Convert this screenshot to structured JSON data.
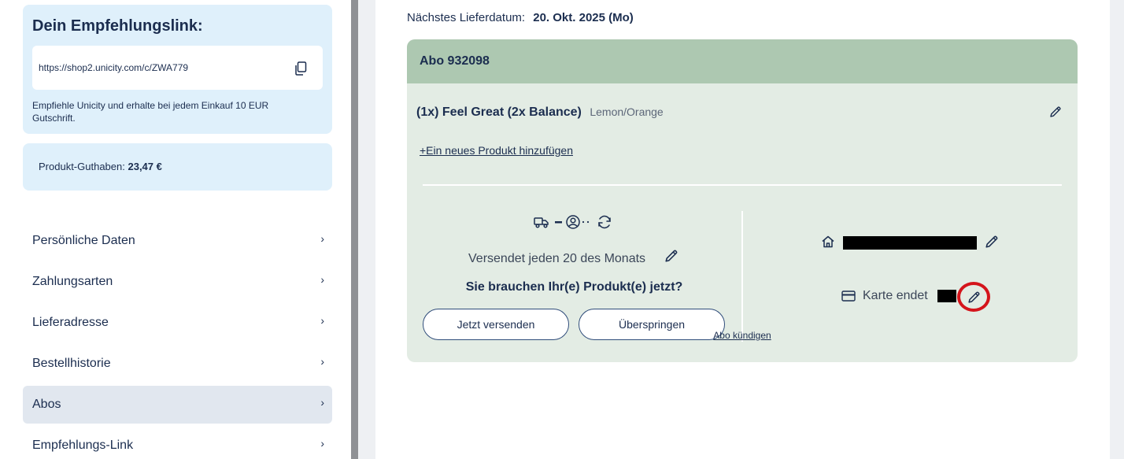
{
  "referral": {
    "title": "Dein Empfehlungslink:",
    "url": "https://shop2.unicity.com/c/ZWA779",
    "description": "Empfiehle Unicity und erhalte bei jedem Einkauf 10 EUR Gutschrift."
  },
  "credit": {
    "label": "Produkt-Guthaben:",
    "value": "23,47 €"
  },
  "nav": {
    "items": [
      {
        "label": "Persönliche Daten"
      },
      {
        "label": "Zahlungsarten"
      },
      {
        "label": "Lieferadresse"
      },
      {
        "label": "Bestellhistorie"
      },
      {
        "label": "Abos",
        "active": true
      },
      {
        "label": "Empfehlungs-Link"
      }
    ],
    "chevron": "›"
  },
  "main": {
    "next_delivery_label": "Nächstes Lieferdatum:",
    "next_delivery_value": "20. Okt. 2025 (Mo)",
    "subscription": {
      "title": "Abo 932098",
      "product_name": "(1x) Feel Great (2x Balance)",
      "product_variant": "Lemon/Orange",
      "add_product_label": "+Ein neues Produkt hinzufügen",
      "ship_schedule": "Versendet jeden 20 des Monats",
      "need_now": "Sie brauchen Ihr(e) Produkt(e) jetzt?",
      "ship_now_label": "Jetzt versenden",
      "skip_label": "Überspringen",
      "card_label": "Karte endet",
      "cancel_label": "Abo kündigen"
    }
  },
  "colors": {
    "primary_text": "#1b2d4f",
    "info_card_bg": "#dff0fb",
    "abo_header_bg": "#adc8b1",
    "abo_body_bg": "#e3ece4",
    "highlight_circle": "#d4141b"
  },
  "icons": [
    "copy-icon",
    "chevron-right-icon",
    "pencil-icon",
    "truck-icon",
    "user-circle-icon",
    "refresh-icon",
    "home-icon",
    "credit-card-icon"
  ]
}
